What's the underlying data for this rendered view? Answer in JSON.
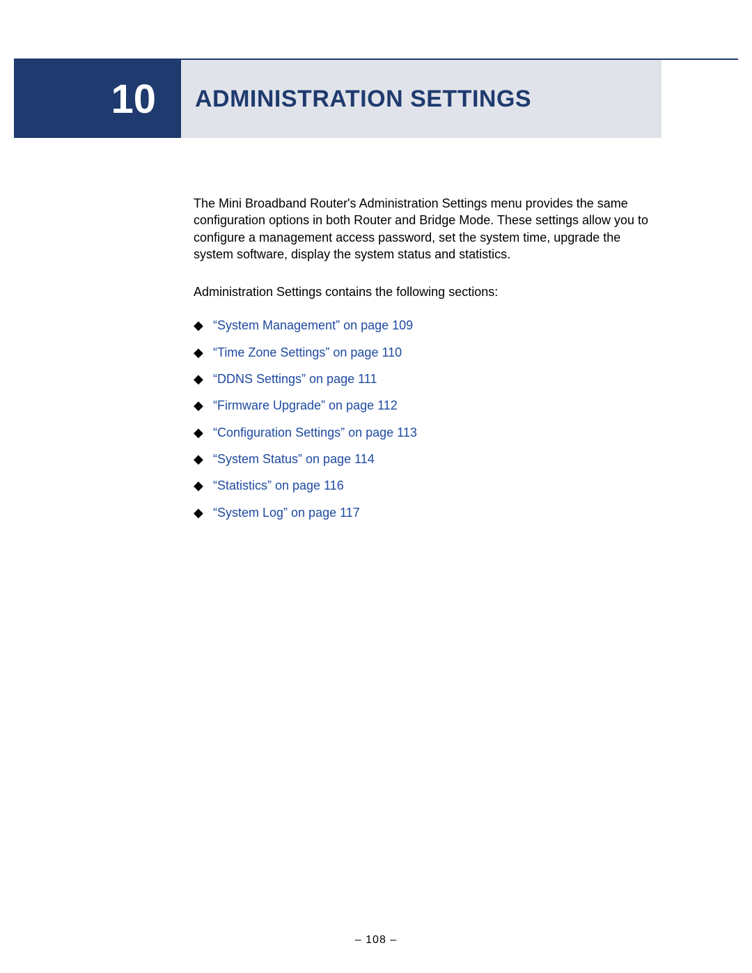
{
  "chapter": {
    "number": "10",
    "title": "ADMINISTRATION SETTINGS"
  },
  "body": {
    "intro": "The Mini Broadband Router's Administration Settings menu provides the same configuration options in both Router and Bridge Mode. These settings allow you to configure a management access password, set the system time, upgrade the system software, display the system status and statistics.",
    "sections_lead": "Administration Settings contains the following sections:"
  },
  "toc": [
    {
      "label": "“System Management” on page 109"
    },
    {
      "label": "“Time Zone Settings” on page 110"
    },
    {
      "label": "“DDNS Settings” on page 111"
    },
    {
      "label": "“Firmware Upgrade” on page 112"
    },
    {
      "label": "“Configuration Settings” on page 113"
    },
    {
      "label": "“System Status” on page 114"
    },
    {
      "label": "“Statistics” on page 116"
    },
    {
      "label": "“System Log” on page 117"
    }
  ],
  "footer": {
    "page_number": "–  108  –"
  },
  "bullet_glyph": "◆"
}
